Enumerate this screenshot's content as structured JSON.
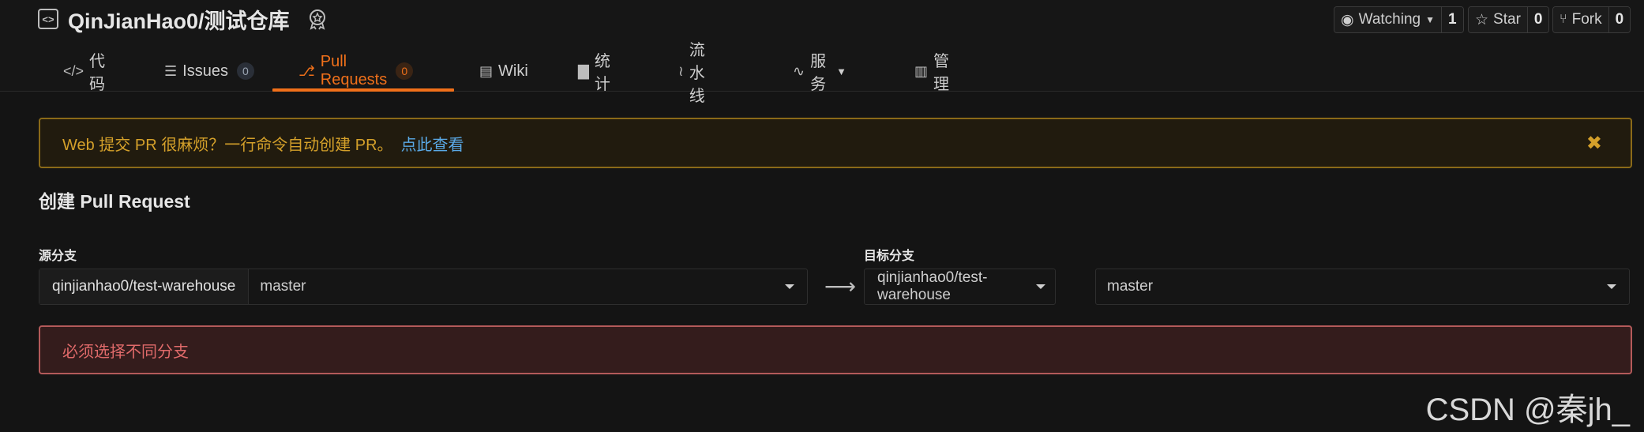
{
  "repo": {
    "name": "QinJianHao0/测试仓库",
    "icon": "repo-icon",
    "badge_icon": "badge-icon"
  },
  "actions": {
    "watching_label": "Watching",
    "watching_count": "1",
    "star_label": "Star",
    "star_count": "0",
    "fork_label": "Fork",
    "fork_count": "0"
  },
  "tabs": [
    {
      "label": "代码",
      "icon": "code-icon"
    },
    {
      "label": "Issues",
      "count": "0",
      "icon": "issues-icon"
    },
    {
      "label": "Pull Requests",
      "count": "0",
      "icon": "pull-request-icon",
      "active": true
    },
    {
      "label": "Wiki",
      "icon": "wiki-icon"
    },
    {
      "label": "统计",
      "icon": "chart-icon"
    },
    {
      "label": "流水线",
      "icon": "pipeline-icon"
    },
    {
      "label": "服务",
      "icon": "pulse-icon"
    },
    {
      "label": "管理",
      "icon": "manage-icon"
    }
  ],
  "notice": {
    "text": "Web 提交 PR 很麻烦？一行命令自动创建 PR。",
    "link": "点此查看"
  },
  "page_title": "创建 Pull Request",
  "source": {
    "label": "源分支",
    "repo": "qinjianhao0/test-warehouse",
    "branch": "master"
  },
  "target": {
    "label": "目标分支",
    "repo": "qinjianhao0/test-warehouse",
    "branch": "master"
  },
  "error": "必须选择不同分支",
  "watermark": "CSDN @秦jh_",
  "colors": {
    "accent": "#f0701a",
    "notice": "#d4a02a",
    "error": "#e06a6a",
    "link": "#5aa9e6"
  }
}
